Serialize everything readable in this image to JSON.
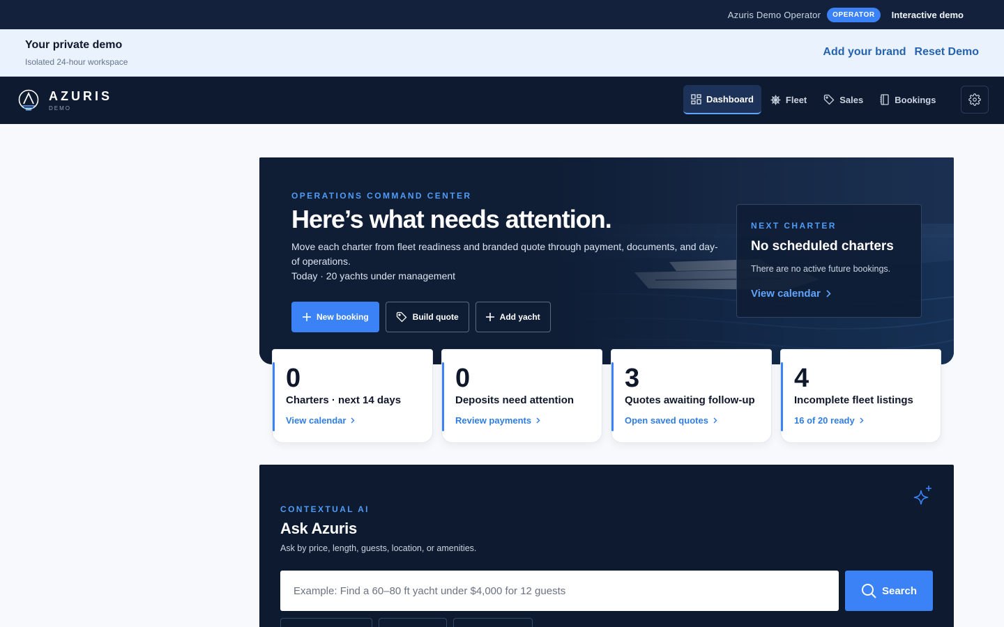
{
  "operator_bar": {
    "operator_name": "Azuris Demo Operator",
    "role_badge": "OPERATOR",
    "mode_label": "Interactive demo"
  },
  "demo_bar": {
    "title": "Your private demo",
    "subtitle": "Isolated 24-hour workspace",
    "add_brand": "Add your brand",
    "reset_demo": "Reset Demo"
  },
  "nav": {
    "brand_name": "AZURIS",
    "brand_sub": "DEMO",
    "items": [
      {
        "label": "Dashboard",
        "icon": "grid-icon",
        "active": true
      },
      {
        "label": "Fleet",
        "icon": "helm-icon",
        "active": false
      },
      {
        "label": "Sales",
        "icon": "tag-icon",
        "active": false
      },
      {
        "label": "Bookings",
        "icon": "book-icon",
        "active": false
      }
    ],
    "settings_icon": "gear-icon"
  },
  "hero": {
    "eyebrow": "OPERATIONS COMMAND CENTER",
    "title": "Here’s what needs attention.",
    "description": "Move each charter from fleet readiness and branded quote through payment, documents, and day-of operations.",
    "today": "Today · 20 yachts under management",
    "buttons": {
      "new_booking": "New booking",
      "build_quote": "Build quote",
      "add_yacht": "Add yacht"
    },
    "next_charter": {
      "eyebrow": "NEXT CHARTER",
      "title": "No scheduled charters",
      "text": "There are no active future bookings.",
      "link": "View calendar"
    }
  },
  "stats": [
    {
      "value": "0",
      "label": "Charters · next 14 days",
      "link": "View calendar"
    },
    {
      "value": "0",
      "label": "Deposits need attention",
      "link": "Review payments"
    },
    {
      "value": "3",
      "label": "Quotes awaiting follow-up",
      "link": "Open saved quotes"
    },
    {
      "value": "4",
      "label": "Incomplete fleet listings",
      "link": "16 of 20 ready"
    }
  ],
  "ai": {
    "eyebrow": "CONTEXTUAL AI",
    "title": "Ask Azuris",
    "subtitle": "Ask by price, length, guests, location, or amenities.",
    "search_placeholder": "Example: Find a 60–80 ft yacht under $4,000 for 12 guests",
    "search_value": "",
    "search_button": "Search"
  },
  "colors": {
    "accent": "#3b82f6",
    "navy": "#0d1a2f",
    "link": "#2f7de1"
  }
}
